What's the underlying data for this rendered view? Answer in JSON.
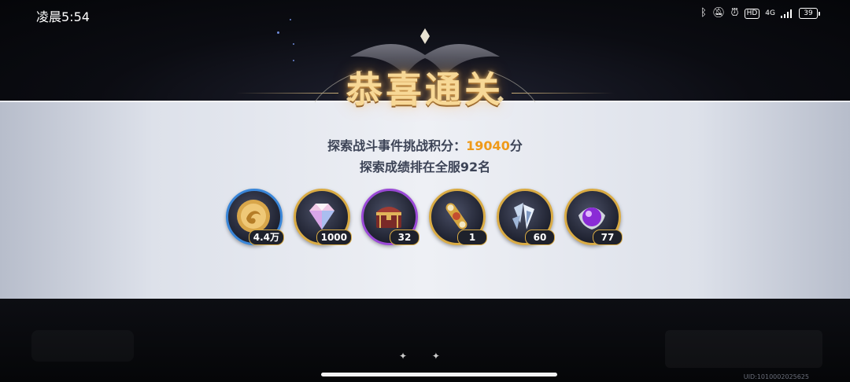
{
  "status_bar": {
    "time": "凌晨5:54",
    "hd": "HD",
    "network": "4G",
    "battery": "39"
  },
  "title": "恭喜通关",
  "score": {
    "label": "探索战斗事件挑战积分：",
    "value": "19040",
    "unit": "分"
  },
  "rank_text": "探索成绩排在全服92名",
  "rewards": [
    {
      "icon": "gold-coin-icon",
      "count": "4.4万",
      "frame": "blue"
    },
    {
      "icon": "diamond-icon",
      "count": "1000",
      "frame": "gold"
    },
    {
      "icon": "treasure-chest-icon",
      "count": "32",
      "frame": "purple"
    },
    {
      "icon": "golden-amulet-icon",
      "count": "1",
      "frame": "gold"
    },
    {
      "icon": "crystal-shard-icon",
      "count": "60",
      "frame": "gold"
    },
    {
      "icon": "purple-orb-icon",
      "count": "77",
      "frame": "gold"
    }
  ],
  "page_dots": "✦ ✦",
  "uid": "UID:1010002025625",
  "colors": {
    "score": "#ef9a1a",
    "title": "#f7d896",
    "frame_gold": "#d9ab44",
    "frame_blue": "#3a86d8",
    "frame_purple": "#9a49d6"
  }
}
